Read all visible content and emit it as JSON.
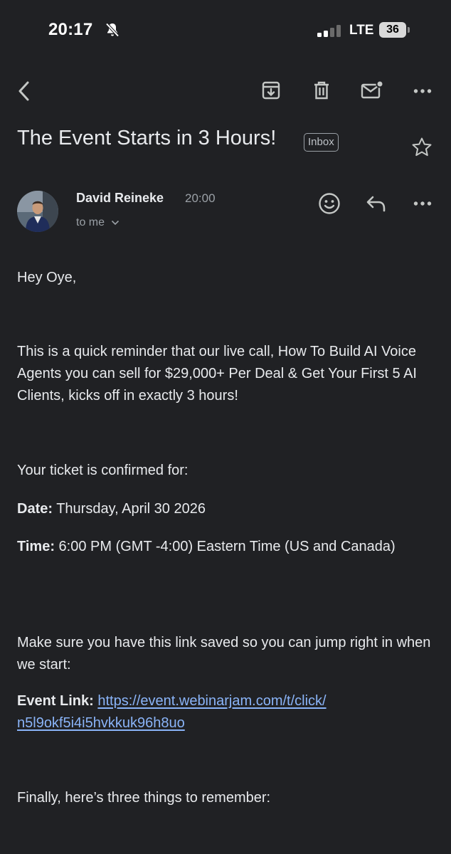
{
  "status_bar": {
    "time": "20:17",
    "network": "LTE",
    "battery": "36",
    "icons": [
      "bell-slash-icon",
      "signal-icon"
    ]
  },
  "toolbar": {
    "icons": [
      "back-arrow-icon",
      "archive-icon",
      "trash-icon",
      "mark-unread-icon",
      "more-icon"
    ]
  },
  "email": {
    "subject": "The Event Starts in 3 Hours!",
    "label": "Inbox",
    "sender": "David Reineke",
    "sent_time": "20:00",
    "recipient": "to me",
    "greeting": "Hey Oye,",
    "intro": "This is a quick reminder that our live call, How To Build AI Voice Agents you can sell for $29,000+ Per Deal & Get Your First 5 AI Clients, kicks off in exactly 3 hours!",
    "ticket_line": "Your ticket is confirmed for:",
    "date_label": "Date:",
    "date_value": " Thursday, April 30 2026",
    "time_label": "Time:",
    "time_value": " 6:00 PM (GMT -4:00) Eastern Time (US and Canada)",
    "link_intro": "Make sure you have this link saved so you can jump right in when we start:",
    "link_label": "Event Link:",
    "link_line1": "https://event.webinarjam.com/t/click/",
    "link_line2": "n5l9okf5i4i5hvkkuk96h8uo",
    "finally": "Finally, here’s three things to remember:"
  },
  "colors": {
    "background": "#202124",
    "text": "#e8eaed",
    "muted": "#9aa0a6",
    "link": "#8ab4f8"
  }
}
